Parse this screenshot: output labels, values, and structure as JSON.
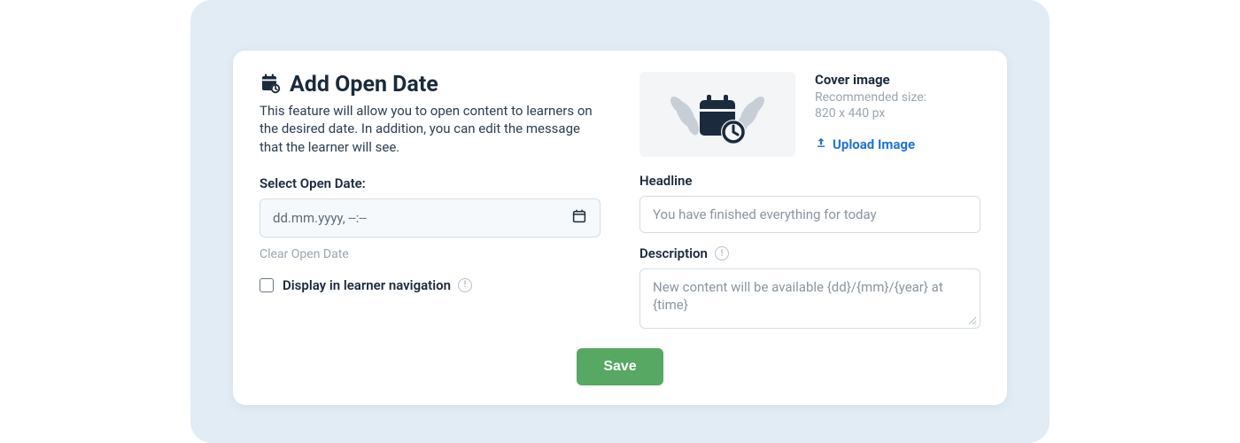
{
  "header": {
    "title": "Add Open Date",
    "subtitle": "This feature will allow you to open content to learners on the desired date. In addition, you can edit the message that the learner will see."
  },
  "form": {
    "open_date_label": "Select Open Date:",
    "open_date_placeholder": "dd.mm.yyyy, --:--",
    "clear_open_date": "Clear Open Date",
    "display_nav_label": "Display in learner navigation"
  },
  "cover": {
    "title": "Cover image",
    "hint_line1": "Recommended size:",
    "hint_line2": "820 x 440 px",
    "upload_label": "Upload Image"
  },
  "headline": {
    "label": "Headline",
    "placeholder": "You have finished everything for today"
  },
  "description": {
    "label": "Description",
    "placeholder": "New content will be available {dd}/{mm}/{year} at {time}"
  },
  "actions": {
    "save": "Save"
  }
}
